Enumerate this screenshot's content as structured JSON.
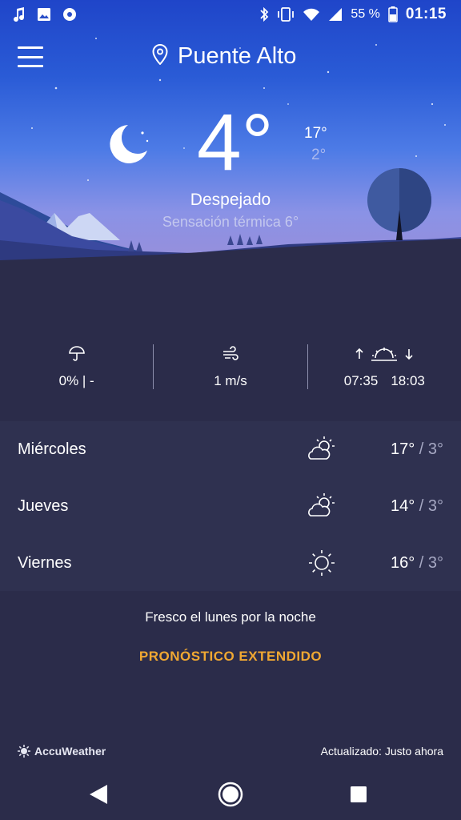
{
  "status_bar": {
    "left_icons": [
      "music-note-icon",
      "image-icon",
      "circle-dot-icon"
    ],
    "right_icons": [
      "bluetooth-icon",
      "vibrate-icon",
      "wifi-icon",
      "signal-icon",
      "battery-icon"
    ],
    "battery": "55 %",
    "time": "01:15"
  },
  "header": {
    "location": "Puente Alto"
  },
  "current": {
    "temperature": "4°",
    "high": "17°",
    "low": "2°",
    "condition": "Despejado",
    "feels_like": "Sensación térmica 6°"
  },
  "stats": {
    "precipitation": "0% | -",
    "wind": "1 m/s",
    "sunrise": "07:35",
    "sunset": "18:03"
  },
  "forecast": [
    {
      "day": "Miércoles",
      "icon": "partly-cloudy-icon",
      "high": "17°",
      "separator": " / ",
      "low": "3°"
    },
    {
      "day": "Jueves",
      "icon": "partly-cloudy-icon",
      "high": "14°",
      "separator": " / ",
      "low": "3°"
    },
    {
      "day": "Viernes",
      "icon": "sun-icon",
      "high": "16°",
      "separator": " / ",
      "low": "3°"
    }
  ],
  "summary": "Fresco el lunes por la noche",
  "extended_link": "PRONÓSTICO EXTENDIDO",
  "footer": {
    "brand": "AccuWeather",
    "updated": "Actualizado: Justo ahora"
  },
  "colors": {
    "background": "#2b2c4a",
    "accent": "#f0a832",
    "sky_top": "#1f45c9",
    "muted_text": "#a7a9c4"
  }
}
